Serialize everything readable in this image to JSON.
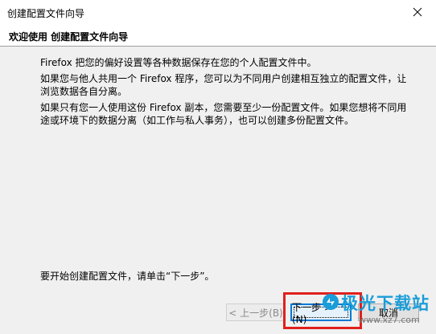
{
  "window": {
    "title": "创建配置文件向导",
    "close_icon": "close-icon"
  },
  "header": {
    "title": "欢迎使用 创建配置文件向导"
  },
  "content": {
    "para1": "Firefox 把您的偏好设置等各种数据保存在您的个人配置文件中。",
    "para2": "如果您与他人共用一个 Firefox 程序，您可以为不同用户创建相互独立的配置文件，让浏览数据各自分离。",
    "para3": "如果只有您一人使用这份 Firefox 副本，您需要至少一份配置文件。如果您想将不同用途或环境下的数据分离（如工作与私人事务），也可以创建多份配置文件。",
    "instruction": "要开始创建配置文件，请单击“下一步”。"
  },
  "buttons": {
    "back": "< 上一步(B)",
    "next": "下一步 > (N)",
    "cancel": "取消"
  },
  "watermark": {
    "logo": "极光下载站",
    "site": "www.xz7.com"
  },
  "colors": {
    "highlight": "#e0201c",
    "accent": "#0078d7",
    "watermark": "#1a9dd8"
  }
}
